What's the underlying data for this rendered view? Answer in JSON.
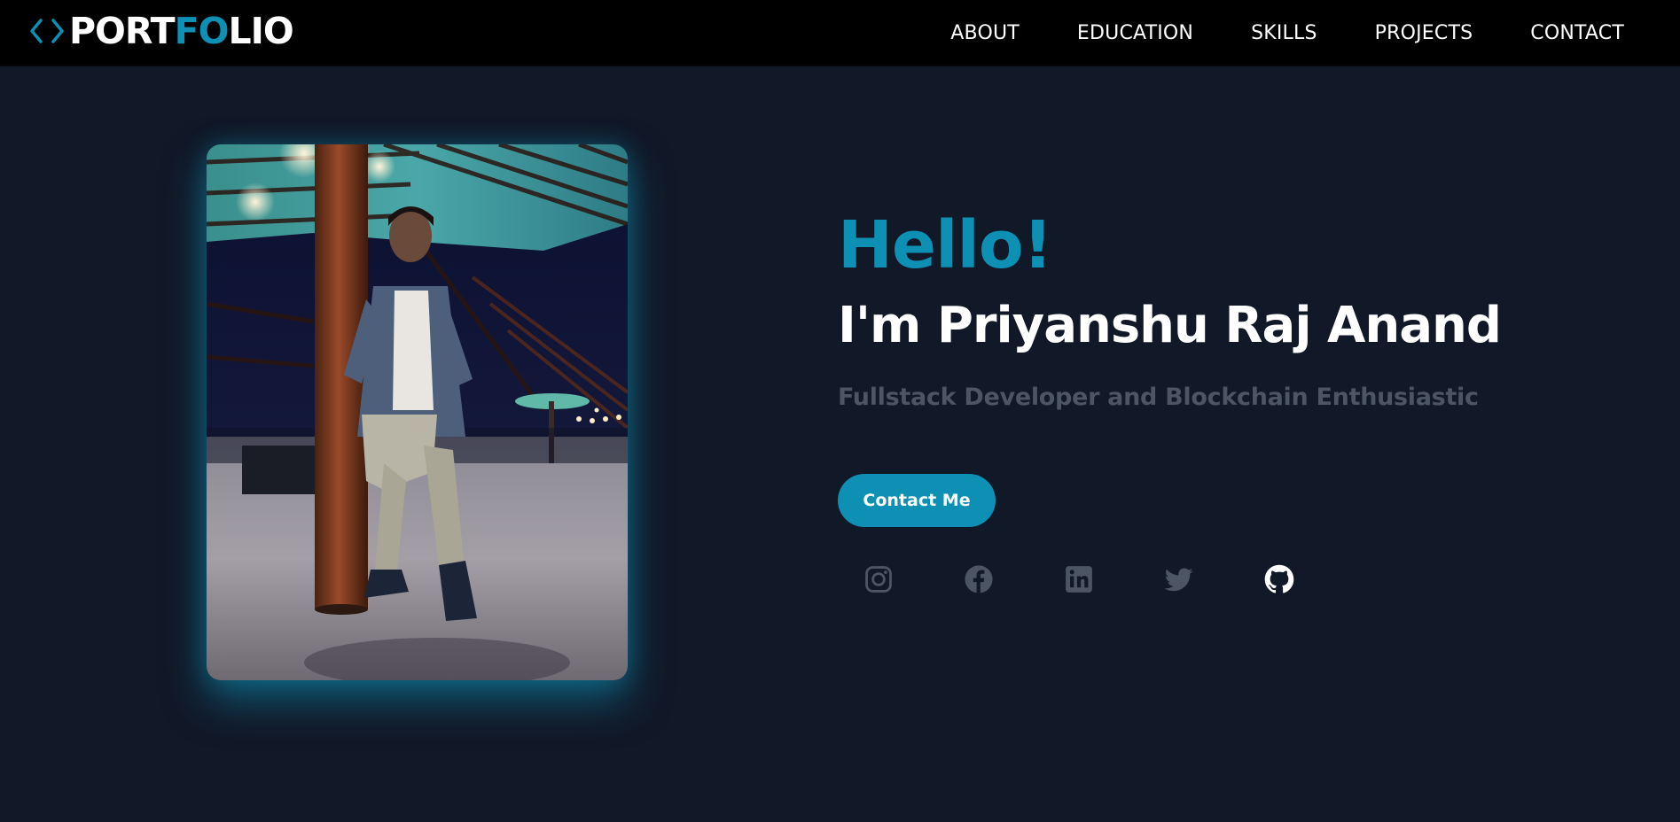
{
  "header": {
    "logo": {
      "chevron_icon": "code-brackets-icon",
      "text_part1": "PORT",
      "text_highlight": "FO",
      "text_part2": "LIO",
      "accent_color": "#0e8fb4"
    },
    "nav": [
      {
        "label": "ABOUT"
      },
      {
        "label": "EDUCATION"
      },
      {
        "label": "SKILLS"
      },
      {
        "label": "PROJECTS"
      },
      {
        "label": "CONTACT"
      }
    ]
  },
  "hero": {
    "photo_icon": "profile-photo",
    "greeting": "Hello!",
    "name": "I'm Priyanshu Raj Anand",
    "tagline": "Fullstack Developer and Blockchain Enthusiastic",
    "cta_label": "Contact Me",
    "socials": [
      {
        "icon": "instagram-icon",
        "color": "#4b5563"
      },
      {
        "icon": "facebook-icon",
        "color": "#4b5563"
      },
      {
        "icon": "linkedin-icon",
        "color": "#4b5563"
      },
      {
        "icon": "twitter-icon",
        "color": "#4b5563"
      },
      {
        "icon": "github-icon",
        "color": "#ffffff"
      }
    ]
  },
  "colors": {
    "background": "#111827",
    "navbar": "#000000",
    "accent": "#0e8fb4",
    "muted": "#4b5563"
  }
}
